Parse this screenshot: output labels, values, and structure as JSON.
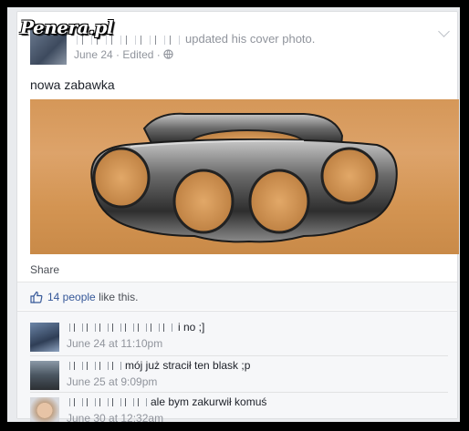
{
  "watermark": "Penera.pl",
  "post": {
    "action": "updated his cover photo.",
    "date": "June 24",
    "edited": "Edited",
    "separator": "·",
    "text": "nowa zabawka",
    "share_label": "Share"
  },
  "likes": {
    "count_text": "14 people",
    "suffix": "like this."
  },
  "comments": [
    {
      "text": "i no ;]",
      "time": "June 24 at 11:10pm"
    },
    {
      "text": "mój już stracił ten blask ;p",
      "time": "June 25 at 9:09pm"
    },
    {
      "text": "ale bym zakurwił komuś",
      "time": "June 30 at 12:32am"
    }
  ],
  "colors": {
    "link": "#365899",
    "meta": "#90949c",
    "background": "#e9ebee"
  },
  "icons": {
    "privacy": "globe-icon",
    "like": "thumbs-up-icon",
    "menu": "chevron-down-icon"
  }
}
